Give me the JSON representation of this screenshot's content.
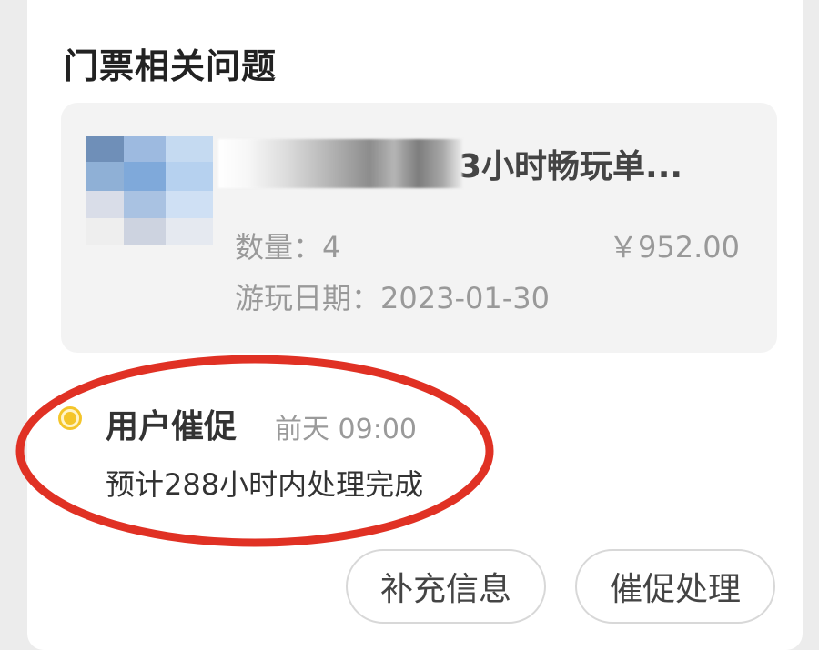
{
  "section": {
    "title": "门票相关问题"
  },
  "product": {
    "name_visible_suffix": "3小时畅玩单...",
    "quantity_label": "数量：",
    "quantity_value": "4",
    "price": "￥952.00",
    "date_label": "游玩日期：",
    "date_value": "2023-01-30",
    "thumbnail_icon": "blurred-product-thumbnail"
  },
  "status": {
    "title": "用户催促",
    "time": "前天 09:00",
    "description": "预计288小时内处理完成",
    "dot_color": "#f4c52a",
    "highlight_color": "#e03124"
  },
  "actions": {
    "supplement_label": "补充信息",
    "urge_label": "催促处理"
  }
}
